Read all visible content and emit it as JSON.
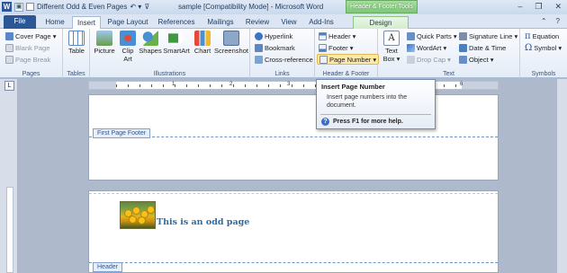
{
  "titlebar": {
    "app_letter": "W",
    "qat_label": "Different Odd & Even Pages",
    "doc_title": "sample [Compatibility Mode] - Microsoft Word",
    "contextual_tools": "Header & Footer Tools",
    "minimize": "–",
    "restore": "❐",
    "close": "✕"
  },
  "tabs": {
    "file": "File",
    "home": "Home",
    "insert": "Insert",
    "page_layout": "Page Layout",
    "references": "References",
    "mailings": "Mailings",
    "review": "Review",
    "view": "View",
    "addins": "Add-Ins",
    "design": "Design",
    "collapse": "⌃",
    "help": "?"
  },
  "ribbon": {
    "pages": {
      "label": "Pages",
      "cover_page": "Cover Page ▾",
      "blank_page": "Blank Page",
      "page_break": "Page Break"
    },
    "tables": {
      "label": "Tables",
      "table": "Table"
    },
    "illustrations": {
      "label": "Illustrations",
      "picture": "Picture",
      "clip_art": "Clip Art",
      "shapes": "Shapes",
      "smartart": "SmartArt",
      "chart": "Chart",
      "screenshot": "Screenshot"
    },
    "links": {
      "label": "Links",
      "hyperlink": "Hyperlink",
      "bookmark": "Bookmark",
      "cross_reference": "Cross-reference"
    },
    "header_footer": {
      "label": "Header & Footer",
      "header": "Header ▾",
      "footer": "Footer ▾",
      "page_number": "Page Number ▾"
    },
    "text": {
      "label": "Text",
      "text_box": "Text Box ▾",
      "quick_parts": "Quick Parts ▾",
      "wordart": "WordArt ▾",
      "drop_cap": "Drop Cap ▾",
      "signature_line": "Signature Line ▾",
      "date_time": "Date & Time",
      "object": "Object ▾"
    },
    "symbols": {
      "label": "Symbols",
      "equation": "Equation",
      "symbol": "Symbol ▾"
    }
  },
  "tooltip": {
    "title": "Insert Page Number",
    "description": "Insert page numbers into the document.",
    "help": "Press F1 for more help."
  },
  "document": {
    "footer_tab": "First Page Footer",
    "header_tab": "Header",
    "odd_text": "This is an odd page"
  },
  "ruler": {
    "numbers": [
      "1",
      "2",
      "3",
      "4",
      "5",
      "6"
    ]
  },
  "colors": {
    "file_tab": "#2b5797",
    "contextual": "#7cc877",
    "heading_text": "#2e6ca6"
  }
}
